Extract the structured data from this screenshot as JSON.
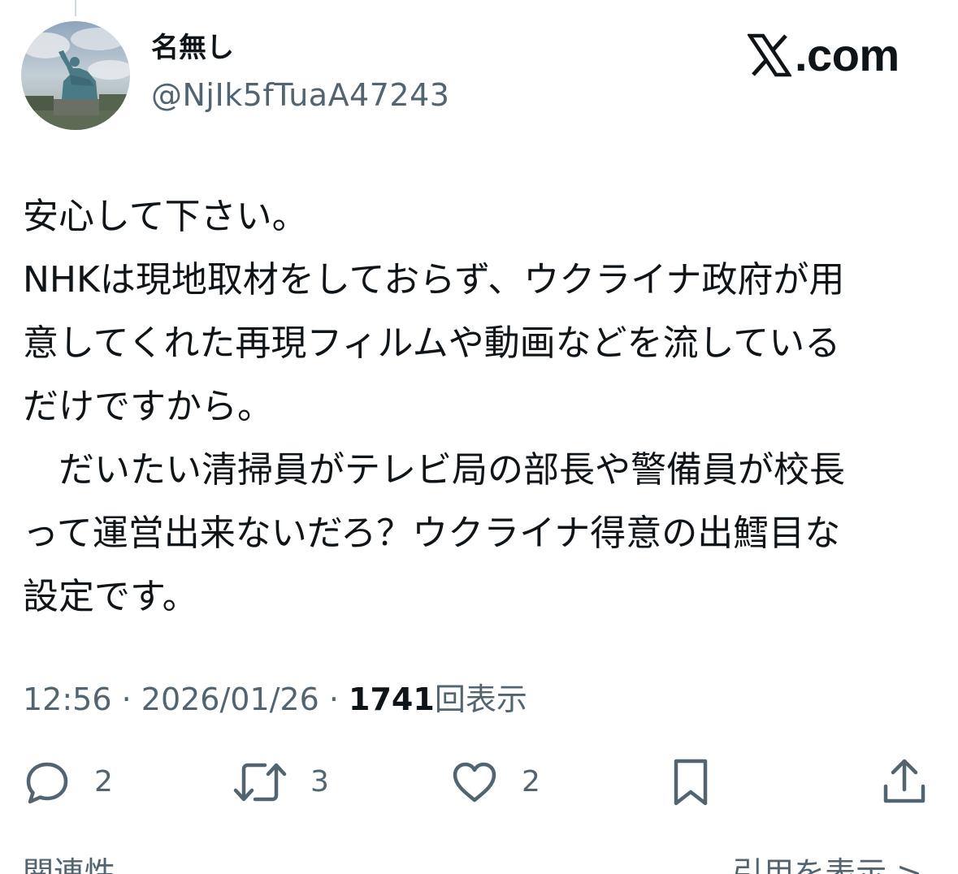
{
  "author": {
    "name": "名無し",
    "handle": "@NjIk5fTuaA47243"
  },
  "brand": {
    "text": ".com",
    "logo_icon": "x-logo-icon"
  },
  "post": {
    "lines": [
      "安心して下さい。",
      "NHKは現地取材をしておらず、ウクライナ政府が用",
      "意してくれた再現フィルムや動画などを流している",
      "だけですから。",
      "　だいたい清掃員がテレビ局の部長や警備員が校長",
      "って運営出来ないだろ？ウクライナ得意の出鱈目な",
      "設定です。"
    ]
  },
  "meta": {
    "time": "12:56",
    "separator": " · ",
    "date": "2026/01/26",
    "views_count": "1741",
    "views_label": "回表示"
  },
  "actions": {
    "reply_count": "2",
    "repost_count": "3",
    "like_count": "2"
  },
  "bottom": {
    "left_label": "関連性",
    "right_label": "引用を表示 >"
  },
  "colors": {
    "text_primary": "#0f1419",
    "text_secondary": "#536471",
    "background": "#ffffff"
  }
}
